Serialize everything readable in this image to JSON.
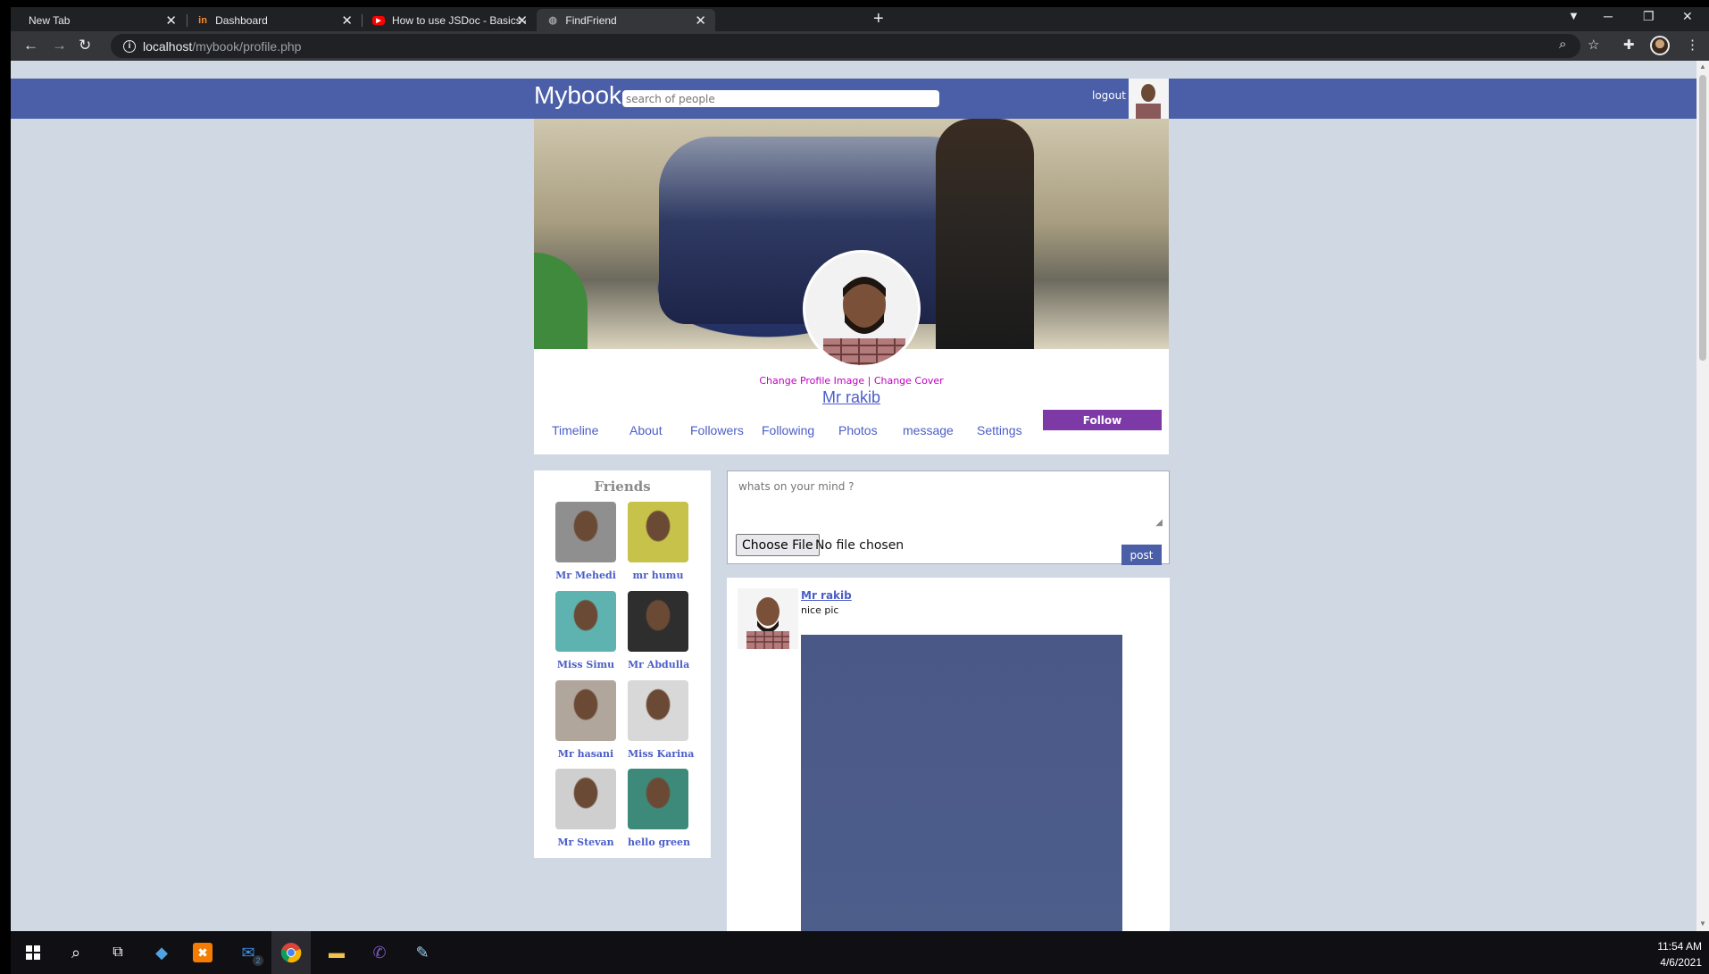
{
  "browser": {
    "tabs": [
      {
        "title": "New Tab",
        "icon": "blank-icon"
      },
      {
        "title": "Dashboard",
        "icon": "invision-icon"
      },
      {
        "title": "How to use JSDoc - Basics & Intr",
        "icon": "youtube-icon"
      },
      {
        "title": "FindFriend",
        "icon": "globe-icon"
      }
    ],
    "url_host": "localhost",
    "url_path": "/mybook/profile.php"
  },
  "header": {
    "brand": "Mybook",
    "search_placeholder": "search of people",
    "logout_label": "logout"
  },
  "profile": {
    "change_image_label": "Change Profile Image",
    "separator": " | ",
    "change_cover_label": "Change Cover",
    "name": "Mr rakib",
    "follow_label": "Follow",
    "nav": [
      "Timeline",
      "About",
      "Followers",
      "Following",
      "Photos",
      "message",
      "Settings"
    ]
  },
  "friends": {
    "title": "Friends",
    "items": [
      {
        "name": "Mr Mehedi",
        "color": "#8f8f8f"
      },
      {
        "name": "mr humu",
        "color": "#c6c24a"
      },
      {
        "name": "Miss Simu",
        "color": "#5eb3b0"
      },
      {
        "name": "Mr Abdulla",
        "color": "#2e2e2e"
      },
      {
        "name": "Mr hasani",
        "color": "#b0a69c"
      },
      {
        "name": "Miss Karina",
        "color": "#d8d8d8"
      },
      {
        "name": "Mr Stevan",
        "color": "#cfcfcf"
      },
      {
        "name": "hello green",
        "color": "#3d8a7a"
      }
    ]
  },
  "composer": {
    "placeholder": "whats on your mind ?",
    "choose_file_label": "Choose File",
    "no_file_label": "No file chosen",
    "post_label": "post"
  },
  "post": {
    "author": "Mr rakib",
    "text": "nice pic"
  },
  "taskbar": {
    "time": "11:54 AM",
    "date": "4/6/2021",
    "mail_badge": "2"
  },
  "colors": {
    "accent": "#4b5ea8",
    "follow": "#7d3aa6",
    "link": "#4b5ec8",
    "change_links": "#c000c0"
  }
}
